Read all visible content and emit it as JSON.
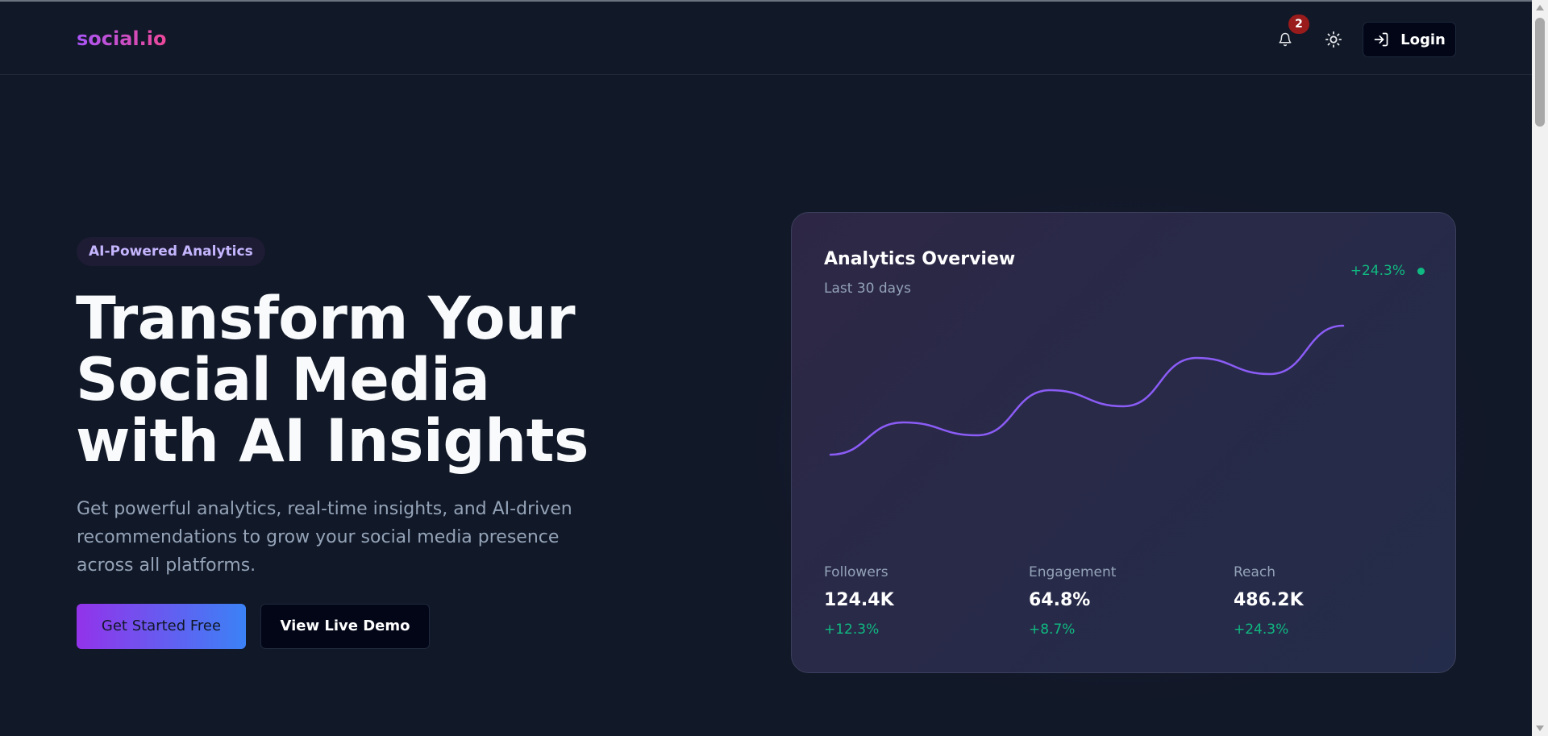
{
  "header": {
    "logo": "social.io",
    "notification_count": "2",
    "login_label": "Login",
    "icons": {
      "notifications": "bell-icon",
      "theme": "sun-icon",
      "login": "log-in-icon"
    }
  },
  "hero": {
    "badge": "AI-Powered Analytics",
    "title_line1": "Transform Your Social Media",
    "title_line2": "with AI Insights",
    "subtitle": "Get powerful analytics, real-time insights, and AI-driven recommendations to grow your social media presence across all platforms.",
    "cta_primary": "Get Started Free",
    "cta_secondary": "View Live Demo"
  },
  "analytics_card": {
    "title": "Analytics Overview",
    "period": "Last 30 days",
    "change": "+24.3%",
    "stats": [
      {
        "label": "Followers",
        "value": "124.4K",
        "change": "+12.3%"
      },
      {
        "label": "Engagement",
        "value": "64.8%",
        "change": "+8.7%"
      },
      {
        "label": "Reach",
        "value": "486.2K",
        "change": "+24.3%"
      }
    ]
  },
  "chart_data": {
    "type": "line",
    "x": [
      0,
      1,
      2,
      3,
      4,
      5,
      6,
      7
    ],
    "series": [
      {
        "values": [
          0,
          20,
          12,
          40,
          30,
          60,
          50,
          80
        ]
      }
    ],
    "ylim": [
      0,
      100
    ],
    "grid": false
  },
  "colors": {
    "background": "#111827",
    "accent_purple": "#9333ea",
    "accent_blue": "#3b82f6",
    "line": "#8b5cf6",
    "positive": "#10b981",
    "badge": "#991b1b"
  }
}
